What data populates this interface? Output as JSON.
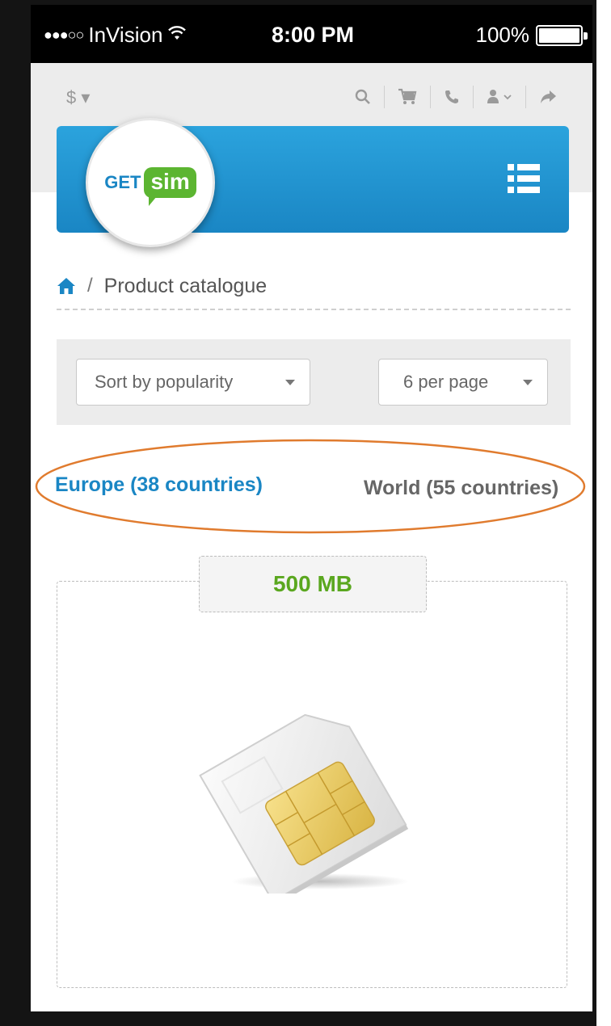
{
  "status_bar": {
    "dots": "●●●○○",
    "carrier": "InVision",
    "time": "8:00 PM",
    "battery": "100%"
  },
  "util_bar": {
    "currency_label": "$ ▾",
    "icons": [
      "search-icon",
      "cart-icon",
      "phone-icon",
      "user-icon",
      "share-icon"
    ]
  },
  "logo": {
    "get_text": "GET",
    "sim_text": "sim"
  },
  "breadcrumb": {
    "separator": "/",
    "current": "Product catalogue"
  },
  "filters": {
    "sort_value": "Sort by popularity",
    "per_page_value": "6 per page"
  },
  "region_tabs": {
    "europe": "Europe (38 countries)",
    "world": "World (55 countries)"
  },
  "product": {
    "label": "500 MB"
  },
  "colors": {
    "brand_blue": "#1a86c4",
    "brand_green": "#5cb531",
    "annotation_orange": "#e07b2e"
  }
}
